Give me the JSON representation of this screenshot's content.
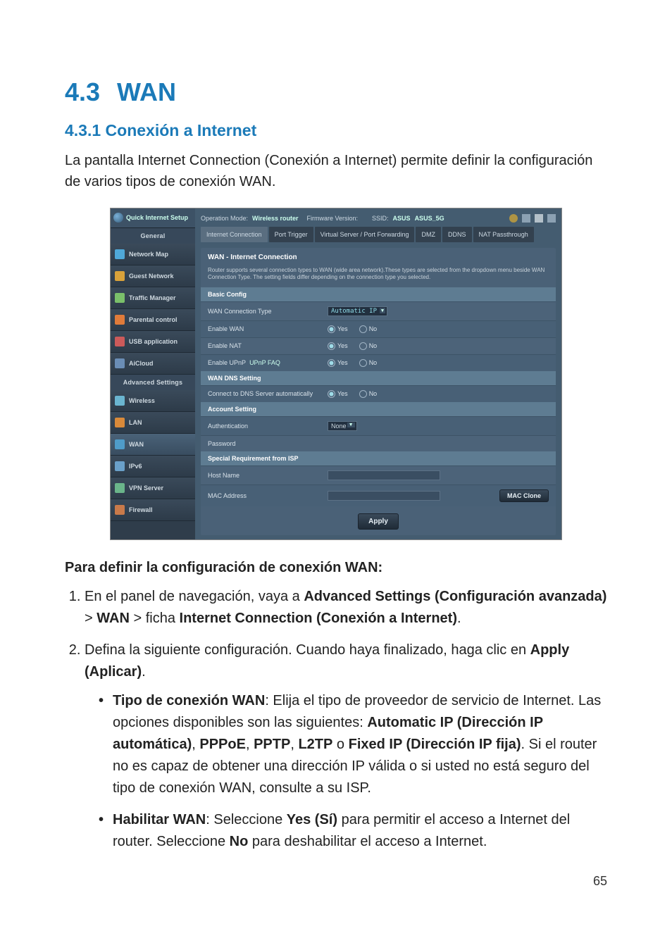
{
  "heading": {
    "num": "4.3",
    "title": "WAN"
  },
  "subheading": "4.3.1 Conexión a Internet",
  "intro": "La pantalla Internet Connection (Conexión a Internet) permite definir la configuración de varios tipos de conexión WAN.",
  "screenshot": {
    "sidebar": {
      "qis": "Quick Internet Setup",
      "general_label": "General",
      "general": [
        {
          "label": "Network Map"
        },
        {
          "label": "Guest Network"
        },
        {
          "label": "Traffic Manager"
        },
        {
          "label": "Parental control"
        },
        {
          "label": "USB application"
        },
        {
          "label": "AiCloud"
        }
      ],
      "adv_label": "Advanced Settings",
      "adv": [
        {
          "label": "Wireless"
        },
        {
          "label": "LAN"
        },
        {
          "label": "WAN"
        },
        {
          "label": "IPv6"
        },
        {
          "label": "VPN Server"
        },
        {
          "label": "Firewall"
        }
      ]
    },
    "topbar": {
      "op_label": "Operation Mode:",
      "op_value": "Wireless router",
      "fw_label": "Firmware Version:",
      "ssid_label": "SSID:",
      "ssid1": "ASUS",
      "ssid2": "ASUS_5G"
    },
    "tabs": [
      "Internet Connection",
      "Port Trigger",
      "Virtual Server / Port Forwarding",
      "DMZ",
      "DDNS",
      "NAT Passthrough"
    ],
    "panel": {
      "title": "WAN - Internet Connection",
      "desc": "Router supports several connection types to WAN (wide area network).These types are selected from the dropdown menu beside WAN Connection Type. The setting fields differ depending on the connection type you selected.",
      "sections": {
        "basic": {
          "title": "Basic Config",
          "rows": {
            "wan_type_label": "WAN Connection Type",
            "wan_type_value": "Automatic IP",
            "enable_wan": "Enable WAN",
            "enable_nat": "Enable NAT",
            "enable_upnp": "Enable UPnP",
            "upnp_faq": "UPnP FAQ",
            "yes": "Yes",
            "no": "No"
          }
        },
        "dns": {
          "title": "WAN DNS Setting",
          "row": "Connect to DNS Server automatically"
        },
        "acct": {
          "title": "Account Setting",
          "auth": "Authentication",
          "auth_value": "None",
          "password": "Password"
        },
        "isp": {
          "title": "Special Requirement from ISP",
          "host": "Host Name",
          "mac": "MAC Address",
          "mac_clone": "MAC Clone"
        }
      },
      "apply": "Apply"
    }
  },
  "instructions": {
    "title": "Para definir la configuración de conexión WAN:",
    "step1_a": "En el panel de navegación, vaya a ",
    "step1_b1": "Advanced Settings (Configuración avanzada)",
    "step1_gt": " > ",
    "step1_b2": "WAN",
    "step1_mid": " > ficha ",
    "step1_b3": "Internet Connection (Conexión a Internet)",
    "step1_end": ".",
    "step2_a": "Defina la siguiente configuración. Cuando haya finalizado, haga clic en ",
    "step2_b": "Apply (Aplicar)",
    "step2_end": ".",
    "bullet1_b": "Tipo de conexión WAN",
    "bullet1_t1": ": Elija el tipo de proveedor de servicio de Internet. Las opciones disponibles son las siguientes: ",
    "bullet1_b2": "Automatic IP (Dirección IP automática)",
    "bullet1_c": ", ",
    "bullet1_b3": "PPPoE",
    "bullet1_b4": "PPTP",
    "bullet1_b5": "L2TP",
    "bullet1_o": " o ",
    "bullet1_b6": "Fixed IP (Dirección IP fija)",
    "bullet1_t2": ". Si el router no es capaz de obtener una dirección IP válida o si usted no está seguro del tipo de conexión WAN, consulte a su ISP.",
    "bullet2_b": "Habilitar WAN",
    "bullet2_t1": ": Seleccione ",
    "bullet2_b2": "Yes (Sí)",
    "bullet2_t2": " para permitir el acceso a Internet del router. Seleccione ",
    "bullet2_b3": "No",
    "bullet2_t3": " para deshabilitar el acceso a Internet."
  },
  "page_number": "65"
}
